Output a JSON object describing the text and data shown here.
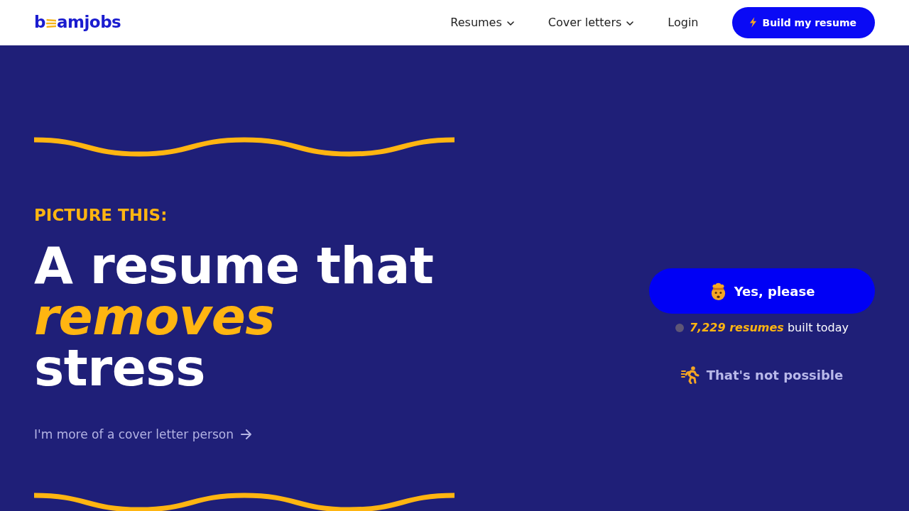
{
  "header": {
    "logo": {
      "text_start": "b",
      "text_end": "amjobs"
    },
    "nav": [
      {
        "label": "Resumes",
        "kind": "dropdown"
      },
      {
        "label": "Cover letters",
        "kind": "dropdown"
      },
      {
        "label": "Login",
        "kind": "link"
      }
    ],
    "cta_button": {
      "label": "Build my resume"
    }
  },
  "hero": {
    "eyebrow": "PICTURE THIS:",
    "headline": "A resume that *removes* stress",
    "cover_letter_link": {
      "label": "I'm more of a cover letter person"
    },
    "yes_button": {
      "label": "Yes, please"
    },
    "counter": "**7,229 resumes** built today",
    "decline_link": {
      "label": "That's not possible"
    }
  }
}
